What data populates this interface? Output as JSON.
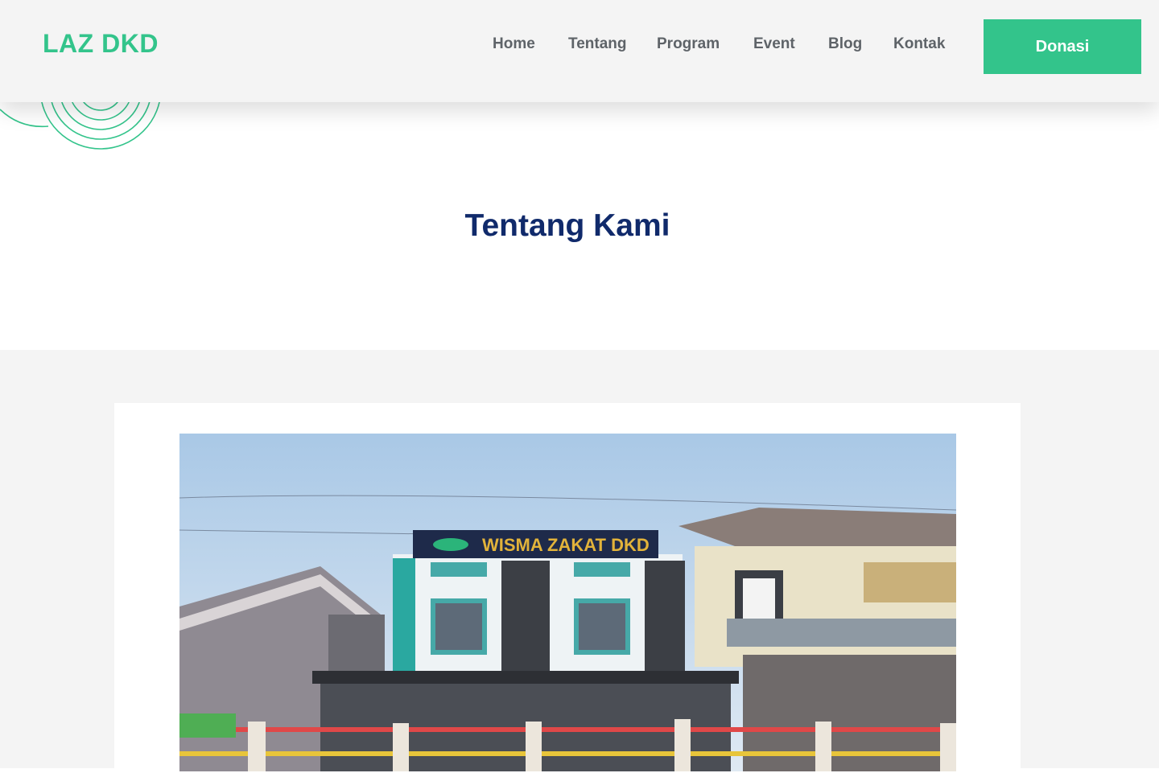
{
  "header": {
    "logo": "LAZ DKD",
    "nav": [
      {
        "label": "Home"
      },
      {
        "label": "Tentang"
      },
      {
        "label": "Program"
      },
      {
        "label": "Event"
      },
      {
        "label": "Blog"
      },
      {
        "label": "Kontak"
      }
    ],
    "donate_label": "Donasi"
  },
  "hero": {
    "title": "Tentang Kami"
  },
  "about": {
    "image": {
      "sign_text": "WISMA ZAKAT DKD"
    }
  },
  "colors": {
    "accent": "#33c48b",
    "title": "#102a6b",
    "nav_text": "#5e6368",
    "header_bg": "#f4f4f4"
  }
}
